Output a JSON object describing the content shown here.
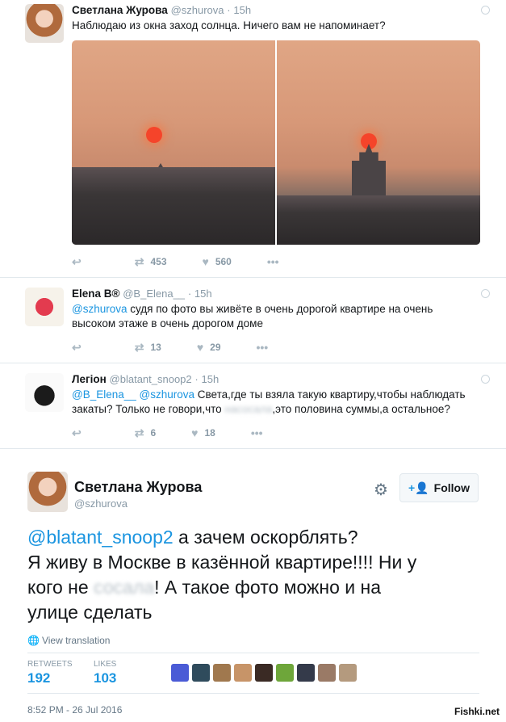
{
  "tweets": [
    {
      "name": "Светлана Журова",
      "handle": "@szhurova",
      "time": "15h",
      "text": "Наблюдаю из окна заход солнца. Ничего вам не напоминает?",
      "retweets": "453",
      "likes": "560"
    },
    {
      "name": "Elena B®",
      "handle": "@B_Elena__",
      "time": "15h",
      "mention": "@szhurova",
      "text_line1": " судя по фото вы живёте в очень дорогой квартире на очень",
      "text_line2": "высоком этаже в очень дорогом доме",
      "retweets": "13",
      "likes": "29"
    },
    {
      "name": "Легіон",
      "handle": "@blatant_snoop2",
      "time": "15h",
      "mention1": "@B_Elena__",
      "mention2": "@szhurova",
      "text_line1": " Света,где ты взяла такую квартиру,чтобы наблюдать",
      "text_line2_a": "закаты? Только не говори,что ",
      "text_line2_blur": "насосала",
      "text_line2_b": ",это половина суммы,а остальное?",
      "retweets": "6",
      "likes": "18"
    }
  ],
  "main_tweet": {
    "name": "Светлана Журова",
    "handle": "@szhurova",
    "follow_label": "Follow",
    "mention": "@blatant_snoop2",
    "line1": "  а зачем оскорблять?",
    "line2": "Я живу в Москве в казённой квартире!!!! Ни у",
    "line3_a": "кого не",
    "line3_blur": " сосала",
    "line3_b": "! А такое фото можно и на",
    "line4": "улице сделать",
    "translate_label": "View translation",
    "retweets_label": "RETWEETS",
    "retweets": "192",
    "likes_label": "LIKES",
    "likes": "103",
    "timestamp": "8:52 PM - 26 Jul 2016"
  },
  "likers_colors": [
    "#4a5bd6",
    "#2f4b5c",
    "#a0784e",
    "#c79468",
    "#3a2a24",
    "#6ea63a",
    "#343a4a",
    "#9a7a66",
    "#b49a7e"
  ],
  "watermark": "Fishki.net",
  "icons": {
    "reply": "reply-icon",
    "retweet": "retweet-icon",
    "like": "heart-icon",
    "more": "more-icon",
    "globe": "globe-icon",
    "gear": "gear-icon",
    "follow": "add-user-icon"
  },
  "colors": {
    "link": "#1b95e0",
    "muted": "#8899a6"
  }
}
